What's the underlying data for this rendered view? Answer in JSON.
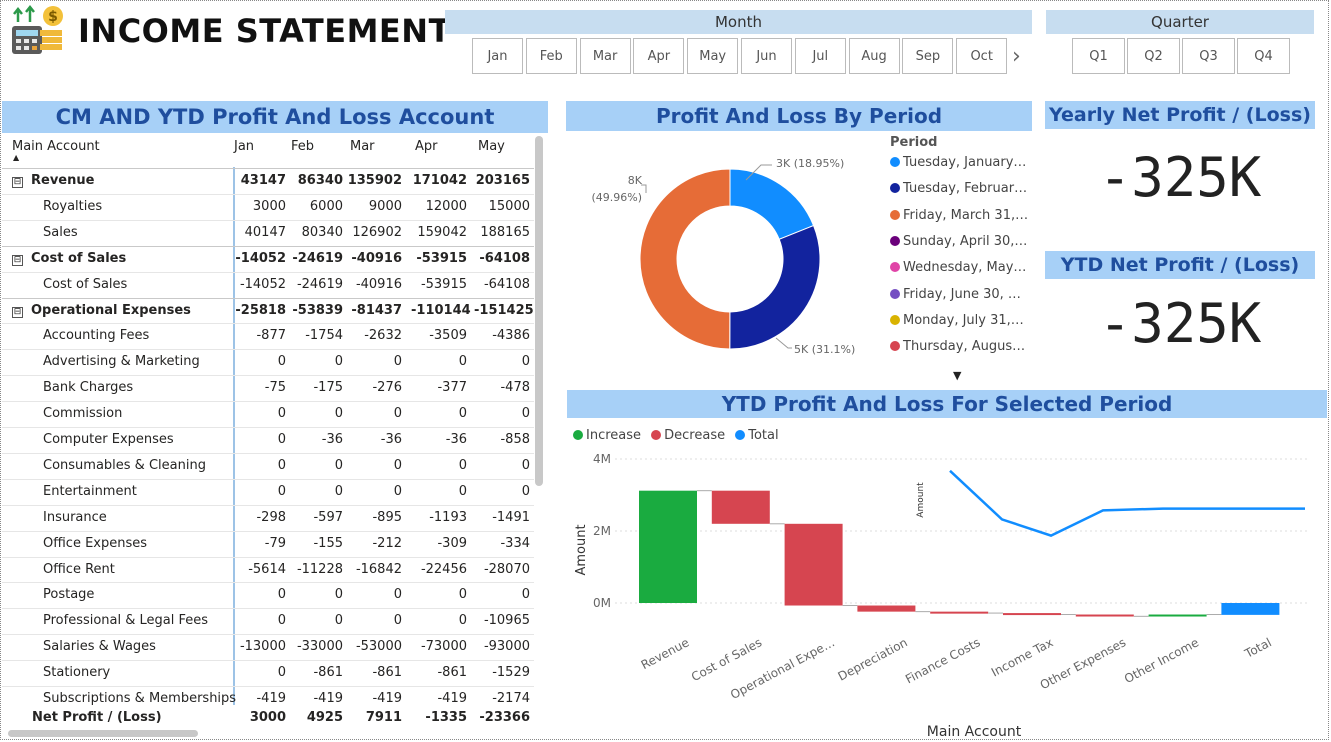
{
  "page_title": "INCOME STATEMENT",
  "month_slicer": {
    "title": "Month",
    "items": [
      "Jan",
      "Feb",
      "Mar",
      "Apr",
      "May",
      "Jun",
      "Jul",
      "Aug",
      "Sep",
      "Oct"
    ],
    "next_arrow": "›"
  },
  "quarter_slicer": {
    "title": "Quarter",
    "items": [
      "Q1",
      "Q2",
      "Q3",
      "Q4"
    ]
  },
  "pl_table": {
    "title": "CM AND YTD Profit And Loss Account",
    "header": {
      "col0": "Main Account",
      "sort_icon": "▲",
      "months": [
        "Jan",
        "Feb",
        "Mar",
        "Apr",
        "May"
      ]
    },
    "rows": [
      {
        "label": "Revenue",
        "values": [
          "43147",
          "86340",
          "135902",
          "171042",
          "203165"
        ],
        "group": true
      },
      {
        "label": "Royalties",
        "values": [
          "3000",
          "6000",
          "9000",
          "12000",
          "15000"
        ],
        "group": false
      },
      {
        "label": "Sales",
        "values": [
          "40147",
          "80340",
          "126902",
          "159042",
          "188165"
        ],
        "group": false
      },
      {
        "label": "Cost of Sales",
        "values": [
          "-14052",
          "-24619",
          "-40916",
          "-53915",
          "-64108"
        ],
        "group": true
      },
      {
        "label": "Cost of Sales",
        "values": [
          "-14052",
          "-24619",
          "-40916",
          "-53915",
          "-64108"
        ],
        "group": false
      },
      {
        "label": "Operational Expenses",
        "values": [
          "-25818",
          "-53839",
          "-81437",
          "-110144",
          "-151425"
        ],
        "group": true
      },
      {
        "label": "Accounting Fees",
        "values": [
          "-877",
          "-1754",
          "-2632",
          "-3509",
          "-4386"
        ],
        "group": false
      },
      {
        "label": "Advertising & Marketing",
        "values": [
          "0",
          "0",
          "0",
          "0",
          "0"
        ],
        "group": false
      },
      {
        "label": "Bank Charges",
        "values": [
          "-75",
          "-175",
          "-276",
          "-377",
          "-478"
        ],
        "group": false
      },
      {
        "label": "Commission",
        "values": [
          "0",
          "0",
          "0",
          "0",
          "0"
        ],
        "group": false
      },
      {
        "label": "Computer Expenses",
        "values": [
          "0",
          "-36",
          "-36",
          "-36",
          "-858"
        ],
        "group": false
      },
      {
        "label": "Consumables & Cleaning",
        "values": [
          "0",
          "0",
          "0",
          "0",
          "0"
        ],
        "group": false
      },
      {
        "label": "Entertainment",
        "values": [
          "0",
          "0",
          "0",
          "0",
          "0"
        ],
        "group": false
      },
      {
        "label": "Insurance",
        "values": [
          "-298",
          "-597",
          "-895",
          "-1193",
          "-1491"
        ],
        "group": false
      },
      {
        "label": "Office Expenses",
        "values": [
          "-79",
          "-155",
          "-212",
          "-309",
          "-334"
        ],
        "group": false
      },
      {
        "label": "Office Rent",
        "values": [
          "-5614",
          "-11228",
          "-16842",
          "-22456",
          "-28070"
        ],
        "group": false
      },
      {
        "label": "Postage",
        "values": [
          "0",
          "0",
          "0",
          "0",
          "0"
        ],
        "group": false
      },
      {
        "label": "Professional & Legal Fees",
        "values": [
          "0",
          "0",
          "0",
          "0",
          "-10965"
        ],
        "group": false
      },
      {
        "label": "Salaries & Wages",
        "values": [
          "-13000",
          "-33000",
          "-53000",
          "-73000",
          "-93000"
        ],
        "group": false
      },
      {
        "label": "Stationery",
        "values": [
          "0",
          "-861",
          "-861",
          "-861",
          "-1529"
        ],
        "group": false
      },
      {
        "label": "Subscriptions & Memberships",
        "values": [
          "-419",
          "-419",
          "-419",
          "-419",
          "-2174"
        ],
        "group": false
      }
    ],
    "total": {
      "label": "Net Profit / (Loss)",
      "values": [
        "3000",
        "4925",
        "7911",
        "-1335",
        "-23366"
      ]
    },
    "expand_icon": "⊟"
  },
  "donut": {
    "title": "Profit And Loss By Period",
    "legend_title": "Period",
    "legend": [
      {
        "label": "Tuesday, January…",
        "color": "#118DFF"
      },
      {
        "label": "Tuesday, Februar…",
        "color": "#12239E"
      },
      {
        "label": "Friday, March 31,…",
        "color": "#E66C37"
      },
      {
        "label": "Sunday, April 30,…",
        "color": "#6B007B"
      },
      {
        "label": "Wednesday, May…",
        "color": "#E044A7"
      },
      {
        "label": "Friday, June 30, …",
        "color": "#744EC2"
      },
      {
        "label": "Monday, July 31,…",
        "color": "#D9B300"
      },
      {
        "label": "Thursday, Augus…",
        "color": "#D64550"
      }
    ],
    "more_icon": "▼",
    "labels": {
      "a": "3K (18.95%)",
      "b": "5K (31.1%)",
      "c1": "8K",
      "c2": "(49.96%)"
    }
  },
  "chart_data": [
    {
      "type": "pie",
      "title": "Profit And Loss By Period",
      "slices": [
        {
          "label": "Tuesday, January…",
          "value": 3000,
          "percent": 18.95,
          "color": "#118DFF"
        },
        {
          "label": "Tuesday, Februar…",
          "value": 4925,
          "percent": 31.1,
          "color": "#12239E"
        },
        {
          "label": "Friday, March 31,…",
          "value": 7911,
          "percent": 49.96,
          "color": "#E66C37"
        }
      ]
    },
    {
      "type": "bar",
      "subtype": "waterfall",
      "title": "YTD Profit And Loss For Selected Period",
      "xlabel": "Main Account",
      "ylabel": "Amount",
      "ylim": [
        -0.5,
        4
      ],
      "y_ticks": [
        "4M",
        "2M",
        "0M"
      ],
      "legend": [
        {
          "name": "Increase",
          "color": "#1AAB40"
        },
        {
          "name": "Decrease",
          "color": "#D64550"
        },
        {
          "name": "Total",
          "color": "#118DFF"
        }
      ],
      "categories": [
        "Revenue",
        "Cost of Sales",
        "Operational Expe…",
        "Depreciation",
        "Finance Costs",
        "Income Tax",
        "Other Expenses",
        "Other Income",
        "Total"
      ],
      "values": [
        3.12,
        -0.92,
        -2.27,
        -0.17,
        -0.04,
        -0.04,
        -0.05,
        0.05,
        -0.33
      ],
      "line": {
        "ylabel": "Amount",
        "values": [
          3.95,
          2.6,
          2.15,
          2.85,
          2.9,
          2.9,
          2.9,
          2.9,
          2.92
        ]
      }
    }
  ],
  "kpi": {
    "yearly_title": "Yearly Net Profit / (Loss)",
    "yearly_value": "-325K",
    "ytd_title": "YTD Net Profit / (Loss)",
    "ytd_value": "-325K"
  },
  "waterfall": {
    "title": "YTD Profit And Loss For Selected Period",
    "legend": [
      "Increase",
      "Decrease",
      "Total"
    ],
    "ylabel": "Amount",
    "xlabel": "Main Account",
    "line_label": "Amount"
  }
}
